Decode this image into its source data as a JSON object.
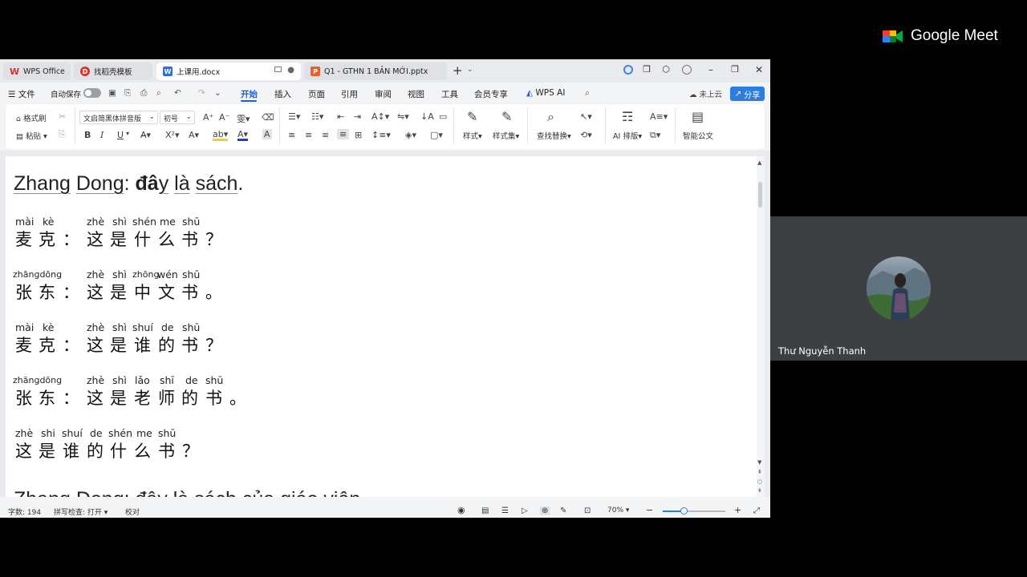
{
  "tabs": [
    {
      "label": "WPS Office",
      "icon": "wps-logo-icon",
      "color": "#e0302b"
    },
    {
      "label": "找稻壳模板",
      "icon": "docer-icon",
      "color": "#e0302b"
    },
    {
      "label": "上课用.docx",
      "icon": "word-doc-icon",
      "color": "#2b6fe0"
    },
    {
      "label": "Q1 - GTHN 1 BẢN MỚI.pptx",
      "icon": "ppt-icon",
      "color": "#e8612c"
    }
  ],
  "menu": {
    "file": "文件",
    "autosave": "自动保存",
    "items": [
      "开始",
      "插入",
      "页面",
      "引用",
      "审阅",
      "视图",
      "工具",
      "会员专享"
    ],
    "wps_ai": "WPS AI",
    "cloud": "未上云",
    "share": "分享"
  },
  "ribbon": {
    "format_painter": "格式刷",
    "paste": "粘贴",
    "font_name": "文启简黑体拼音版",
    "font_size": "初号",
    "bold": "B",
    "italic": "I",
    "underline": "U",
    "styles": "样式",
    "style_set": "样式集",
    "find_replace": "查找替换",
    "ai_layout": "AI 排版",
    "smart_doc": "智能公文"
  },
  "document": {
    "heading": {
      "p1": "Zhang",
      "p2": " ",
      "p3": "Dong",
      "p4": ": ",
      "p5": "đâ",
      "p6": "y",
      "p7": " ",
      "p8": "là",
      "p9": " ",
      "p10": "sách",
      "p11": "."
    },
    "lines": [
      {
        "pinyin": [
          [
            "mài",
            19
          ],
          [
            "kè",
            53
          ],
          [
            "zhè",
            108
          ],
          [
            "shì",
            140
          ],
          [
            "shén",
            165
          ],
          [
            "me",
            199
          ],
          [
            "shū",
            227
          ]
        ],
        "hanzi": [
          [
            "麦",
            19
          ],
          [
            "克",
            48
          ],
          [
            "：",
            78
          ],
          [
            "这",
            108
          ],
          [
            "是",
            137
          ],
          [
            "什",
            167
          ],
          [
            "么",
            197
          ],
          [
            "书",
            226
          ],
          [
            "？",
            256
          ]
        ]
      },
      {
        "pinyin": [
          [
            "zhāngdōng",
            16,
            "sm"
          ],
          [
            "zhè",
            108
          ],
          [
            "shì",
            140
          ],
          [
            "zhōng",
            165,
            "sm"
          ],
          [
            "wén",
            196
          ],
          [
            "shū",
            227
          ]
        ],
        "hanzi": [
          [
            "张",
            19
          ],
          [
            "东",
            48
          ],
          [
            "：",
            78
          ],
          [
            "这",
            108
          ],
          [
            "是",
            137
          ],
          [
            "中",
            167
          ],
          [
            "文",
            197
          ],
          [
            "书",
            226
          ],
          [
            "。",
            256
          ]
        ]
      },
      {
        "pinyin": [
          [
            "mài",
            19
          ],
          [
            "kè",
            53
          ],
          [
            "zhè",
            108
          ],
          [
            "shì",
            140
          ],
          [
            "shuí",
            165
          ],
          [
            "de",
            201
          ],
          [
            "shū",
            227
          ]
        ],
        "hanzi": [
          [
            "麦",
            19
          ],
          [
            "克",
            48
          ],
          [
            "：",
            78
          ],
          [
            "这",
            108
          ],
          [
            "是",
            137
          ],
          [
            "谁",
            167
          ],
          [
            "的",
            197
          ],
          [
            "书",
            226
          ],
          [
            "？",
            256
          ]
        ]
      },
      {
        "pinyin": [
          [
            "zhāngdōng",
            16,
            "sm"
          ],
          [
            "zhè",
            108
          ],
          [
            "shì",
            140
          ],
          [
            "lǎo",
            168
          ],
          [
            "shī",
            199
          ],
          [
            "de",
            231
          ],
          [
            "shū",
            256
          ]
        ],
        "hanzi": [
          [
            "张",
            19
          ],
          [
            "东",
            48
          ],
          [
            "：",
            78
          ],
          [
            "这",
            108
          ],
          [
            "是",
            137
          ],
          [
            "老",
            167
          ],
          [
            "师",
            197
          ],
          [
            "的",
            226
          ],
          [
            "书",
            256
          ],
          [
            "。",
            286
          ]
        ]
      },
      {
        "pinyin": [
          [
            "zhè",
            19
          ],
          [
            "shi",
            51
          ],
          [
            "shuí",
            77
          ],
          [
            "de",
            112
          ],
          [
            "shén",
            135
          ],
          [
            "me",
            170
          ],
          [
            "shū",
            197
          ]
        ],
        "hanzi": [
          [
            "这",
            19
          ],
          [
            "是",
            48
          ],
          [
            "谁",
            78
          ],
          [
            "的",
            108
          ],
          [
            "什",
            137
          ],
          [
            "么",
            167
          ],
          [
            "书",
            197
          ],
          [
            "？",
            227
          ]
        ]
      }
    ],
    "cut_line": "Zhang Dong: đây là sách của giáo viên."
  },
  "status": {
    "word_count": "字数: 194",
    "spell_check": "拼写检查: 打开",
    "proofread": "校对",
    "zoom": "70%",
    "zoom_fraction": 0.33
  },
  "meet": {
    "title": "Google Meet",
    "participant": "Thư Nguyễn Thanh"
  },
  "colors": {
    "accent": "#1a5fe0",
    "share_button": "#2a7de1",
    "tile": "#3c4043"
  }
}
